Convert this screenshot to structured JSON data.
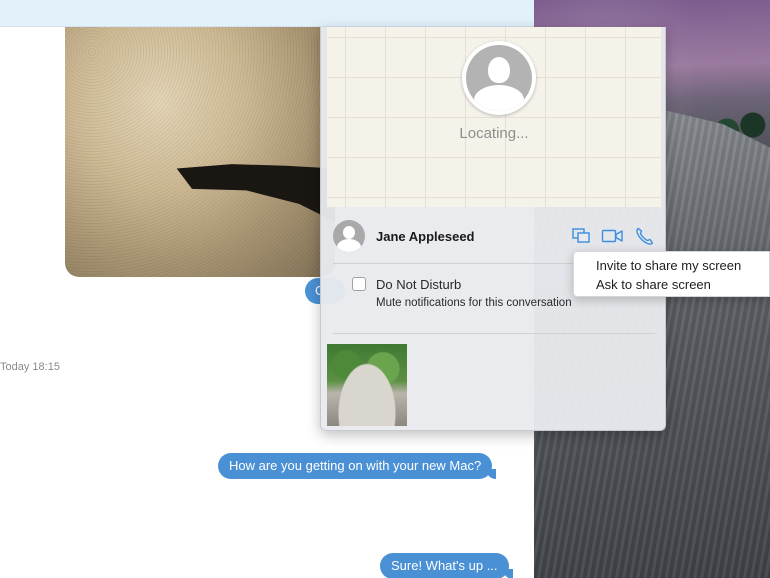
{
  "map": {
    "status": "Locating..."
  },
  "contact": {
    "name": "Jane Appleseed",
    "actions": [
      {
        "icon": "screen-share-icon"
      },
      {
        "icon": "video-camera-icon"
      },
      {
        "icon": "phone-icon"
      }
    ]
  },
  "options": {
    "dnd_label": "Do Not Disturb",
    "dnd_checked": false,
    "dnd_description": "Mute notifications for this conversation"
  },
  "share_menu": {
    "items": [
      {
        "label": "Invite to share my screen"
      },
      {
        "label": "Ask to share screen"
      }
    ]
  },
  "transcript": {
    "partial_bubble_text": "C",
    "timestamp": "Today 18:15",
    "messages": [
      {
        "text": "How are you getting on with your new Mac?"
      },
      {
        "text": "Sure! What's up ..."
      }
    ]
  },
  "colors": {
    "bubble_blue": "#4a90d4",
    "icon_blue": "#3c8ee0",
    "toolbar_bg": "#e3f1fb"
  }
}
